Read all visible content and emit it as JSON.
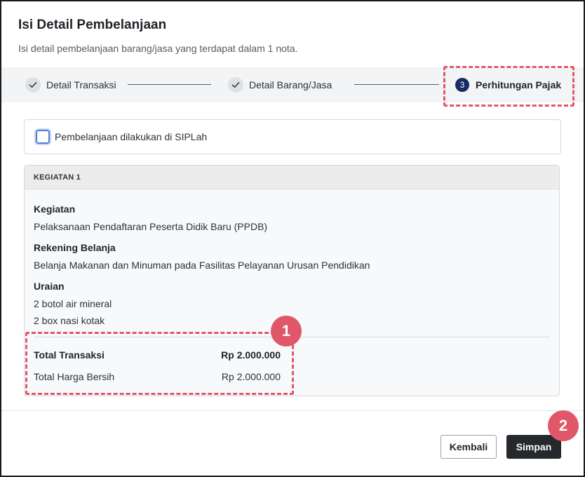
{
  "dialog": {
    "title": "Isi Detail Pembelanjaan",
    "subtitle": "Isi detail pembelanjaan barang/jasa yang terdapat dalam 1 nota."
  },
  "stepper": {
    "steps": [
      {
        "label": "Detail Transaksi",
        "status": "done",
        "icon": "check-icon"
      },
      {
        "label": "Detail Barang/Jasa",
        "status": "done",
        "icon": "check-icon"
      },
      {
        "number": "3",
        "label": "Perhitungan Pajak",
        "status": "active"
      }
    ]
  },
  "siplah": {
    "label": "Pembelanjaan dilakukan di SIPLah",
    "checked": false
  },
  "kegiatan_card": {
    "header": "KEGIATAN 1",
    "kegiatan_label": "Kegiatan",
    "kegiatan_value": "Pelaksanaan Pendaftaran Peserta Didik Baru (PPDB)",
    "rekening_label": "Rekening Belanja",
    "rekening_value": "Belanja Makanan dan Minuman pada Fasilitas Pelayanan Urusan Pendidikan",
    "uraian_label": "Uraian",
    "uraian_items": [
      "2 botol air mineral",
      "2 box nasi kotak"
    ],
    "total_transaksi_label": "Total Transaksi",
    "total_transaksi_value": "Rp 2.000.000",
    "total_harga_bersih_label": "Total Harga Bersih",
    "total_harga_bersih_value": "Rp 2.000.000"
  },
  "annotations": {
    "badge_1": "1",
    "badge_2": "2",
    "color": "#e0576a"
  },
  "footer": {
    "back_label": "Kembali",
    "save_label": "Simpan"
  },
  "colors": {
    "active_step": "#152c64",
    "primary_button": "#25282c",
    "highlight": "#e0576a"
  }
}
